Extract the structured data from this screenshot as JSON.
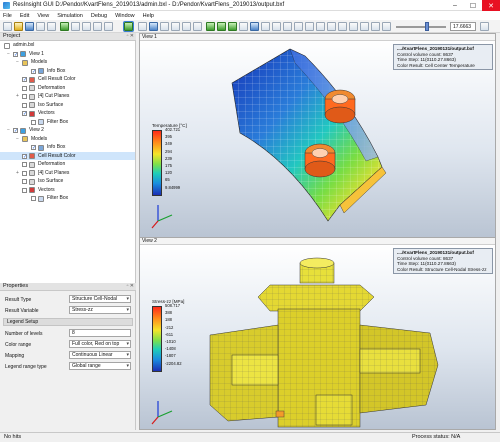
{
  "window": {
    "title": "ResInsight GUI D:/Pendor/KvartFlens_2019013/admin.bxl - D:/Pendor/KvartFlens_2019013/output.bxf",
    "minimize": "–",
    "maximize": "☐",
    "close": "✕"
  },
  "menu": [
    "File",
    "Edit",
    "View",
    "Simulation",
    "Debug",
    "Window",
    "Help"
  ],
  "toolbar": {
    "zoom_value": "17.6663"
  },
  "project": {
    "header": "Project",
    "header_buttons": "▫ ✕",
    "items": [
      {
        "label": "admin.bxl",
        "indent": 0,
        "kind": "file"
      },
      {
        "label": "View 1",
        "indent": 1,
        "kind": "view",
        "checked": true,
        "twisty": "−"
      },
      {
        "label": "Models",
        "indent": 2,
        "kind": "folder",
        "twisty": "−"
      },
      {
        "label": "Info Box",
        "indent": 3,
        "kind": "info",
        "checked": true
      },
      {
        "label": "Cell Result Color",
        "indent": 2,
        "kind": "color",
        "checked": true
      },
      {
        "label": "Deformation",
        "indent": 2,
        "kind": "plain",
        "checked": false
      },
      {
        "label": "[4] Cut Planes",
        "indent": 2,
        "kind": "plain",
        "checked": false,
        "twisty": "+"
      },
      {
        "label": "Iso Surface",
        "indent": 2,
        "kind": "plain",
        "checked": false
      },
      {
        "label": "Vectors",
        "indent": 2,
        "kind": "vector",
        "checked": true
      },
      {
        "label": "Filter Box",
        "indent": 3,
        "kind": "filter",
        "checked": false
      },
      {
        "label": "View 2",
        "indent": 1,
        "kind": "view",
        "checked": true,
        "twisty": "−"
      },
      {
        "label": "Models",
        "indent": 2,
        "kind": "folder",
        "twisty": "−"
      },
      {
        "label": "Info Box",
        "indent": 3,
        "kind": "info",
        "checked": true
      },
      {
        "label": "Cell Result Color",
        "indent": 2,
        "kind": "color",
        "checked": true,
        "selected": true
      },
      {
        "label": "Deformation",
        "indent": 2,
        "kind": "plain",
        "checked": false
      },
      {
        "label": "[4] Cut Planes",
        "indent": 2,
        "kind": "plain",
        "checked": false,
        "twisty": "+"
      },
      {
        "label": "Iso Surface",
        "indent": 2,
        "kind": "plain",
        "checked": false
      },
      {
        "label": "Vectors",
        "indent": 2,
        "kind": "vector",
        "checked": false
      },
      {
        "label": "Filter Box",
        "indent": 3,
        "kind": "filter",
        "checked": false
      }
    ]
  },
  "properties": {
    "header": "Properties",
    "result_type_label": "Result Type",
    "result_type_value": "Structure Cell-Nodal",
    "result_variable_label": "Result Variable",
    "result_variable_value": "Stress-zz",
    "legend_setup_label": "Legend Setup",
    "levels_label": "Number of levels",
    "levels_value": "8",
    "color_range_label": "Color range",
    "color_range_value": "Full color, Red on top",
    "mapping_label": "Mapping",
    "mapping_value": "Continuous Linear",
    "range_type_label": "Legend range type",
    "range_type_value": "Global range"
  },
  "view1": {
    "tab": "View 1",
    "info_title": "..../KvartFlens_20190131/output.bxf",
    "info_line1": "Control volume count: 8637",
    "info_line2": "Time Step: 11(0110.27.8663)",
    "info_line3": "Color Result: Cell Center Temperature",
    "legend_title": "Temperature [°C]",
    "legend_ticks": [
      "402.721",
      "395",
      "349",
      "294",
      "239",
      "175",
      "120",
      "65",
      "9.84999"
    ]
  },
  "view2": {
    "tab": "View 2",
    "info_title": "..../KvartFlens_20190131/output.bxf",
    "info_line1": "Control volume count: 8637",
    "info_line2": "Time Step: 11(0110.27.8663)",
    "info_line3": "Color Result: Structure Cell-Nodal Stress-zz",
    "legend_title": "Stress-zz [MPa]",
    "legend_ticks": [
      "508.717",
      "388",
      "188",
      "-212",
      "-611",
      "-1010",
      "-1408",
      "-1807",
      "-2204.82"
    ]
  },
  "status": {
    "left": "No hits",
    "right": "Process status: N/A"
  },
  "colors": {
    "selection": "#cfe5fb",
    "accent": "#3b7ed6"
  }
}
